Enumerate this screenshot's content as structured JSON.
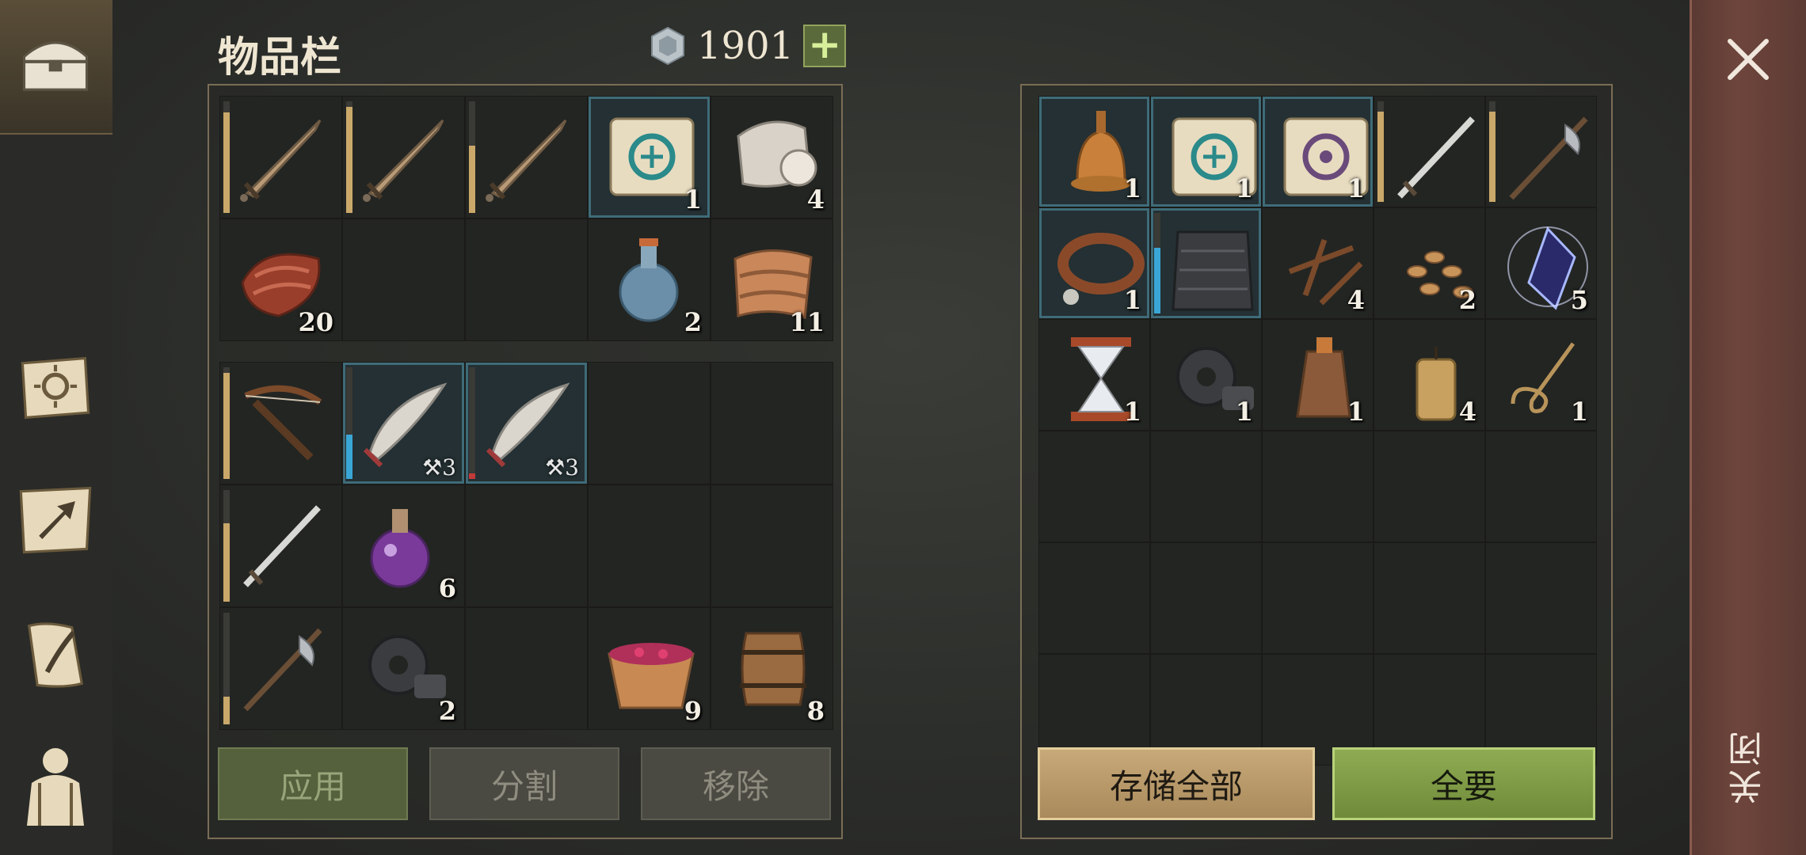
{
  "sidebar": {
    "icons": [
      "chest-icon",
      "sun-book-icon",
      "map-arrow-icon",
      "scroll-quill-icon",
      "backpack-icon"
    ]
  },
  "header": {
    "title": "物品栏",
    "currency_amount": "1901",
    "add_label": "+"
  },
  "close": {
    "label": "关闭"
  },
  "inventory": {
    "top_rows": [
      [
        {
          "icon": "sword-icon",
          "bar": 0.9
        },
        {
          "icon": "sword-icon",
          "bar": 0.95
        },
        {
          "icon": "sword-icon",
          "bar": 0.6
        },
        {
          "icon": "scroll-blue-icon",
          "count": "1",
          "selected": true
        },
        {
          "icon": "cloth-roll-icon",
          "count": "4"
        }
      ],
      [
        {
          "icon": "meat-icon",
          "count": "20"
        },
        {},
        {},
        {
          "icon": "water-bottle-icon",
          "count": "2"
        },
        {
          "icon": "rags-icon",
          "count": "11"
        }
      ]
    ],
    "bottom_rows": [
      [
        {
          "icon": "crossbow-icon",
          "bar": 0.95
        },
        {
          "icon": "scimitar-icon",
          "level": "3",
          "bar": 0.4,
          "barColor": "blue",
          "selected": true
        },
        {
          "icon": "scimitar-icon",
          "level": "3",
          "bar": 0.05,
          "barColor": "red",
          "selected": true
        },
        {},
        {}
      ],
      [
        {
          "icon": "longsword-icon",
          "bar": 0.7
        },
        {
          "icon": "potion-purple-icon",
          "count": "6"
        },
        {},
        {},
        {}
      ],
      [
        {
          "icon": "halberd-icon",
          "bar": 0.25
        },
        {
          "icon": "gear-scrap-icon",
          "count": "2"
        },
        {},
        {
          "icon": "berry-bowl-icon",
          "count": "9"
        },
        {
          "icon": "barrel-icon",
          "count": "8"
        }
      ]
    ],
    "buttons": {
      "apply": "应用",
      "split": "分割",
      "remove": "移除"
    }
  },
  "storage": {
    "rows": [
      [
        {
          "icon": "bell-icon",
          "count": "1",
          "selected": true
        },
        {
          "icon": "scroll-blue-icon",
          "count": "1",
          "selected": true
        },
        {
          "icon": "scroll-purple-icon",
          "count": "1",
          "selected": true
        },
        {
          "icon": "longsword-icon",
          "bar": 0.9
        },
        {
          "icon": "halberd-icon",
          "bar": 0.9
        }
      ],
      [
        {
          "icon": "collar-icon",
          "count": "1",
          "selected": true
        },
        {
          "icon": "chainmail-icon",
          "bar": 0.65,
          "barColor": "blue",
          "selected": true
        },
        {
          "icon": "nails-icon",
          "count": "4"
        },
        {
          "icon": "seeds-icon",
          "count": "2"
        },
        {
          "icon": "crystal-icon",
          "count": "5"
        }
      ],
      [
        {
          "icon": "hourglass-icon",
          "count": "1"
        },
        {
          "icon": "gear-scrap-icon",
          "count": "1"
        },
        {
          "icon": "leather-flask-icon",
          "count": "1"
        },
        {
          "icon": "candle-icon",
          "count": "4"
        },
        {
          "icon": "rope-icon",
          "count": "1"
        }
      ],
      [
        {},
        {},
        {},
        {},
        {}
      ],
      [
        {},
        {},
        {},
        {},
        {}
      ],
      [
        {},
        {},
        {},
        {},
        {}
      ]
    ],
    "buttons": {
      "store_all": "存储全部",
      "take_all": "全要"
    }
  }
}
